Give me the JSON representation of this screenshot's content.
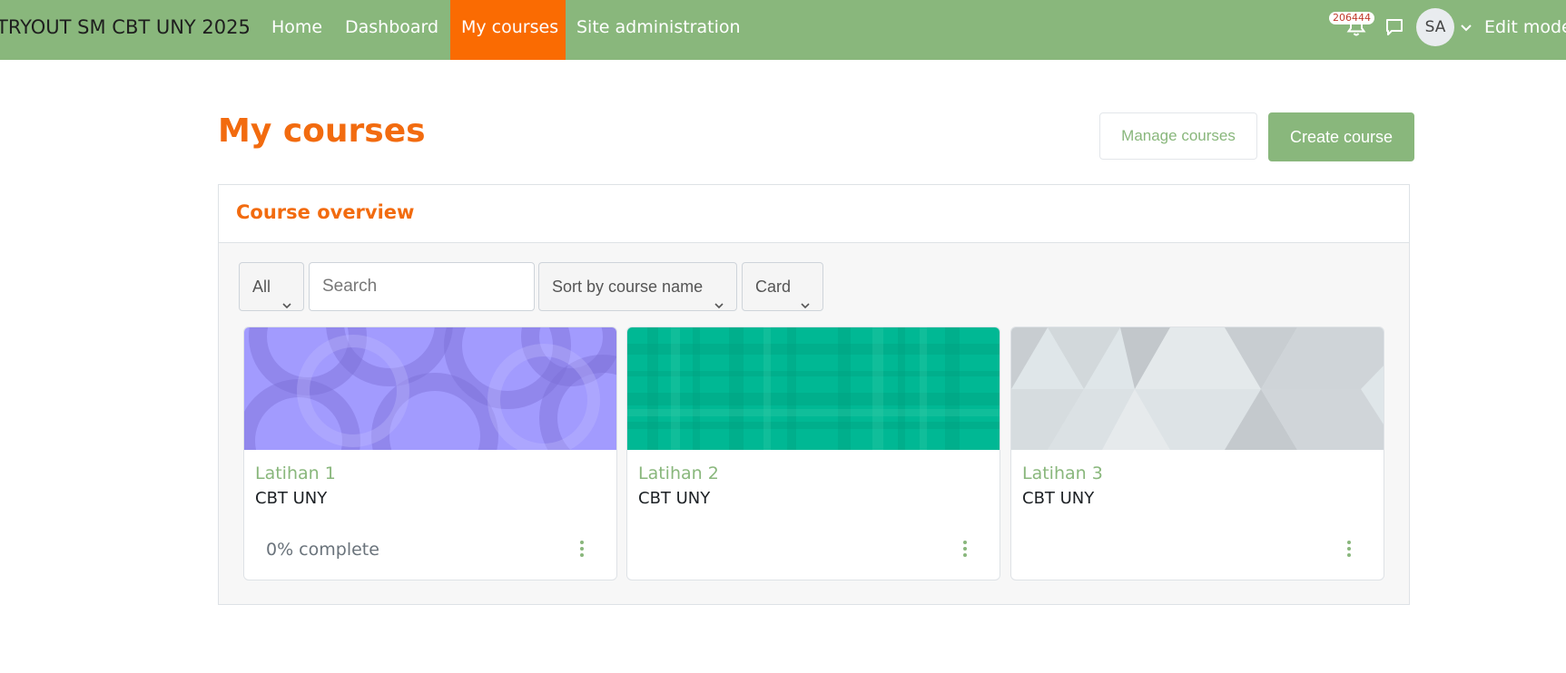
{
  "navbar": {
    "site_name": "TRYOUT SM CBT UNY 2025",
    "items": [
      {
        "label": "Home"
      },
      {
        "label": "Dashboard"
      },
      {
        "label": "My courses"
      },
      {
        "label": "Site administration"
      }
    ],
    "notification_count": "206444",
    "user_initials": "SA",
    "edit_mode_label": "Edit mode",
    "active_color": "#fa6b02",
    "bg_color": "#89b77c"
  },
  "page": {
    "title": "My courses",
    "manage_courses_label": "Manage courses",
    "create_course_label": "Create course",
    "accent_color": "#f26b0f"
  },
  "overview": {
    "title": "Course overview",
    "filter_label": "All",
    "search_placeholder": "Search",
    "sort_label": "Sort by course name",
    "view_label": "Card"
  },
  "courses": [
    {
      "name": "Latihan 1",
      "category": "CBT UNY",
      "progress": "0% complete",
      "image_color": "#a29bfe"
    },
    {
      "name": "Latihan 2",
      "category": "CBT UNY",
      "progress": "",
      "image_color": "#00b894"
    },
    {
      "name": "Latihan 3",
      "category": "CBT UNY",
      "progress": "",
      "image_color": "#dfe6e9"
    }
  ],
  "icons": [
    "bell-icon",
    "message-icon",
    "chevron-down-icon",
    "more-vertical-icon"
  ]
}
